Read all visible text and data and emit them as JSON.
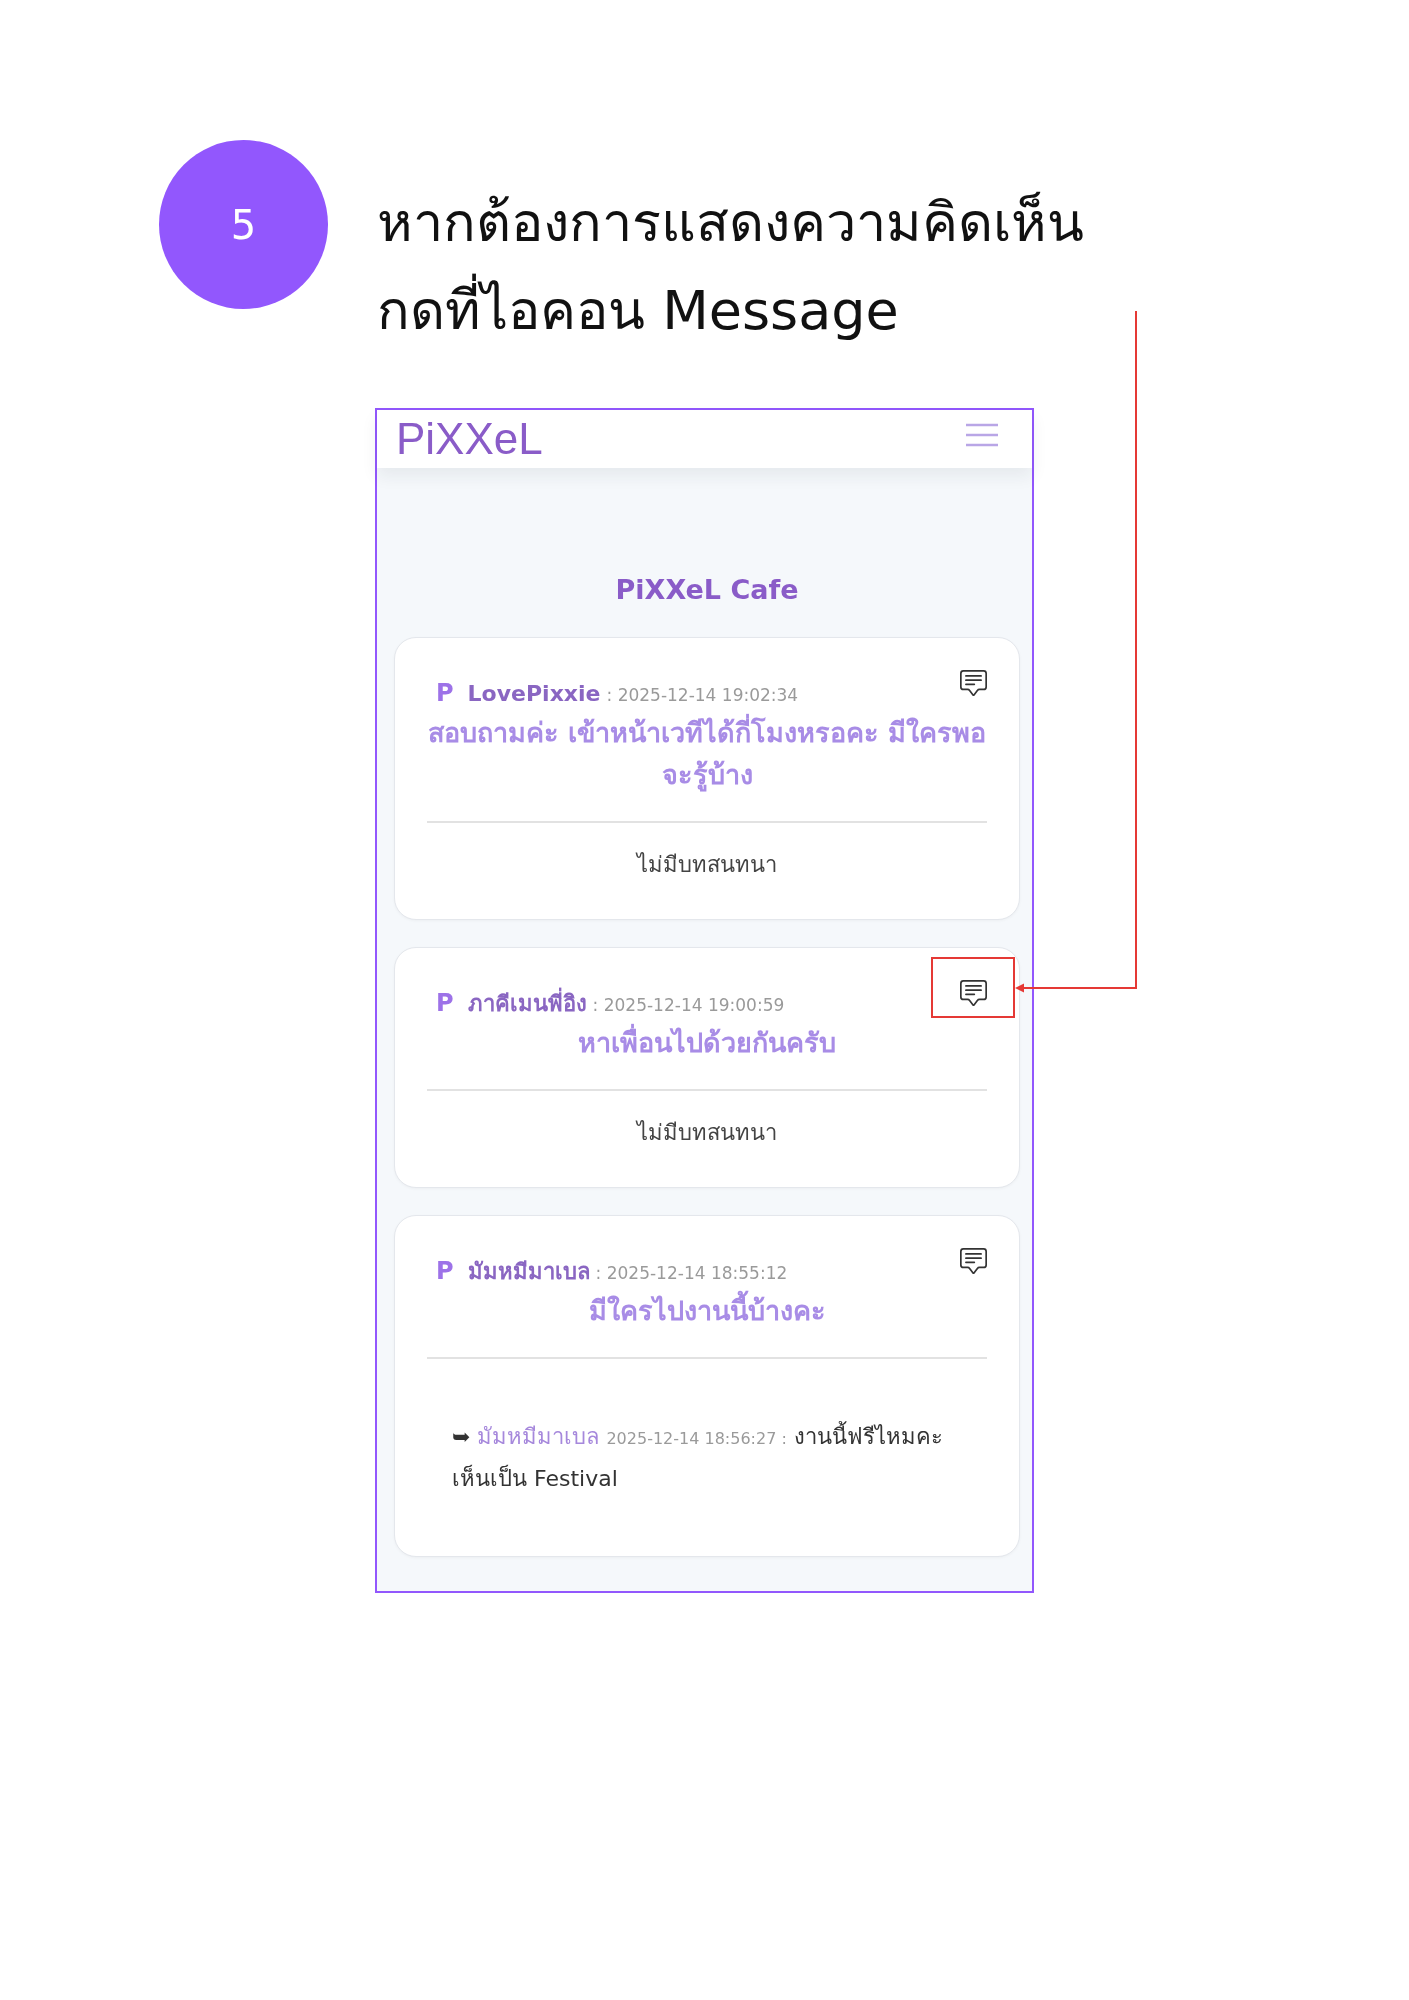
{
  "step": {
    "number": "5",
    "title": "หากต้องการแสดงความคิดเห็น\nกดที่ไอคอน Message"
  },
  "app": {
    "logo": "PiXXeL",
    "page_title": "PiXXeL Cafe"
  },
  "posts": [
    {
      "avatar": "P",
      "author": "LovePixxie",
      "timestamp": ": 2025-12-14 19:02:34",
      "title": "สอบถามค่ะ เข้าหน้าเวทีได้กี่โมงหรอคะ มีใครพอจะรู้บ้าง",
      "highlighted": false,
      "status": "ไม่มีบทสนทนา"
    },
    {
      "avatar": "P",
      "author": "ภาคีเมนพี่อิง",
      "timestamp": ": 2025-12-14 19:00:59",
      "title": "หาเพื่อนไปด้วยกันครับ",
      "highlighted": true,
      "status": "ไม่มีบทสนทนา"
    },
    {
      "avatar": "P",
      "author": "มัมหมีมาเบล",
      "timestamp": ": 2025-12-14 18:55:12",
      "title": "มีใครไปงานนี้บ้างคะ",
      "highlighted": false,
      "replies": [
        {
          "marker": "➥",
          "author": "มัมหมีมาเบล",
          "timestamp": "2025-12-14 18:56:27 :",
          "text": "งานนี้ฟรีไหมคะ เห็นเป็น Festival"
        }
      ]
    }
  ]
}
